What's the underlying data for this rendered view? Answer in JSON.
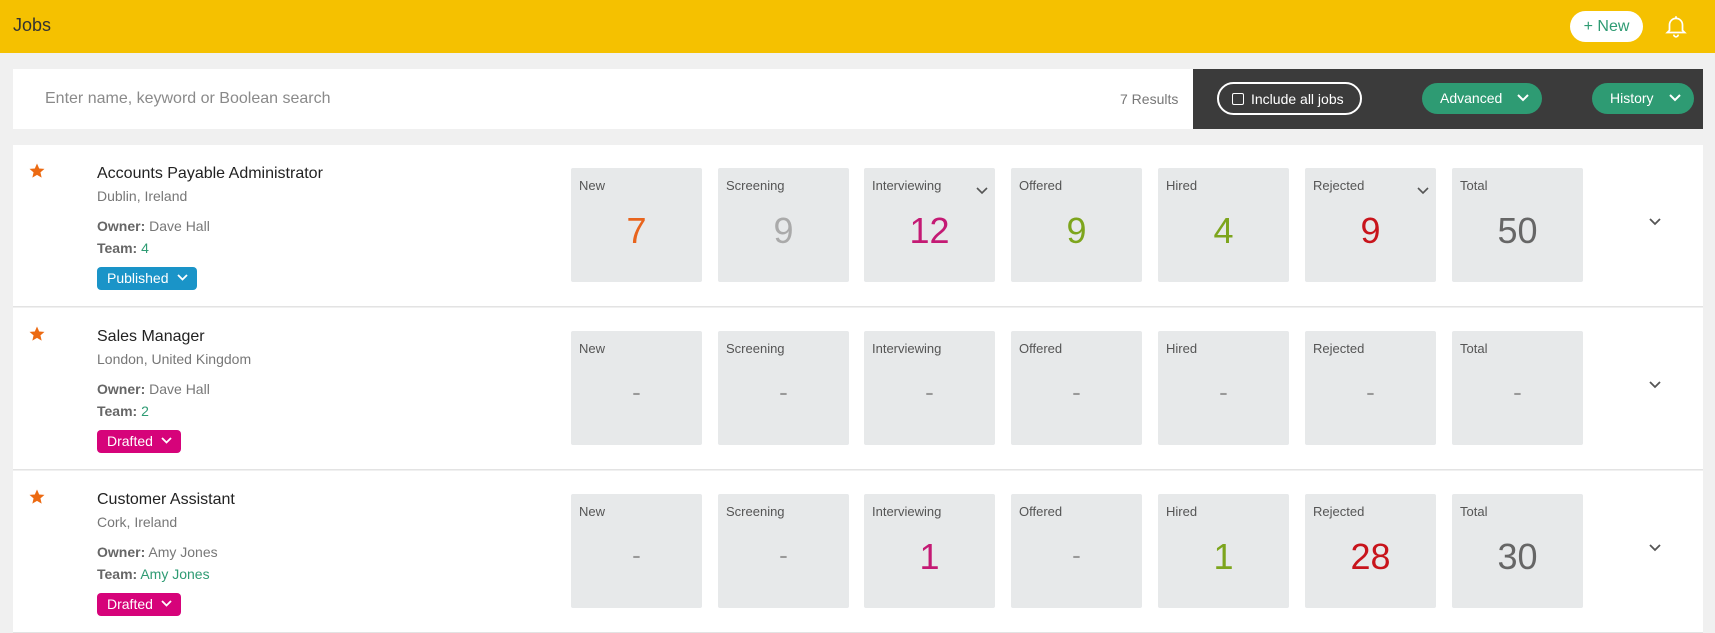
{
  "header": {
    "title": "Jobs",
    "new_label": "+ New"
  },
  "search": {
    "placeholder": "Enter name, keyword or Boolean search",
    "value": "",
    "results": "7 Results"
  },
  "filters": {
    "include_all_label": "Include all jobs",
    "include_all_checked": false,
    "advanced_label": "Advanced",
    "history_label": "History"
  },
  "colors": {
    "brand_yellow": "#f5c100",
    "accent_green": "#2e9b73",
    "published": "#1a94c8",
    "drafted": "#d6037a"
  },
  "stage_labels": {
    "new": "New",
    "screening": "Screening",
    "interviewing": "Interviewing",
    "offered": "Offered",
    "hired": "Hired",
    "rejected": "Rejected",
    "total": "Total"
  },
  "jobs": [
    {
      "title": "Accounts Payable Administrator",
      "location": "Dublin, Ireland",
      "owner_label": "Owner:",
      "owner": "Dave Hall",
      "team_label": "Team:",
      "team": "4",
      "status": "Published",
      "starred": true,
      "stats": {
        "new": "7",
        "screening": "9",
        "interviewing": "12",
        "offered": "9",
        "hired": "4",
        "rejected": "9",
        "total": "50"
      }
    },
    {
      "title": "Sales Manager",
      "location": "London, United Kingdom",
      "owner_label": "Owner:",
      "owner": "Dave Hall",
      "team_label": "Team:",
      "team": "2",
      "status": "Drafted",
      "starred": true,
      "stats": {
        "new": "-",
        "screening": "-",
        "interviewing": "-",
        "offered": "-",
        "hired": "-",
        "rejected": "-",
        "total": "-"
      }
    },
    {
      "title": "Customer Assistant",
      "location": "Cork, Ireland",
      "owner_label": "Owner:",
      "owner": "Amy Jones",
      "team_label": "Team:",
      "team": "Amy Jones",
      "status": "Drafted",
      "starred": true,
      "stats": {
        "new": "-",
        "screening": "-",
        "interviewing": "1",
        "offered": "-",
        "hired": "1",
        "rejected": "28",
        "total": "30"
      }
    }
  ]
}
